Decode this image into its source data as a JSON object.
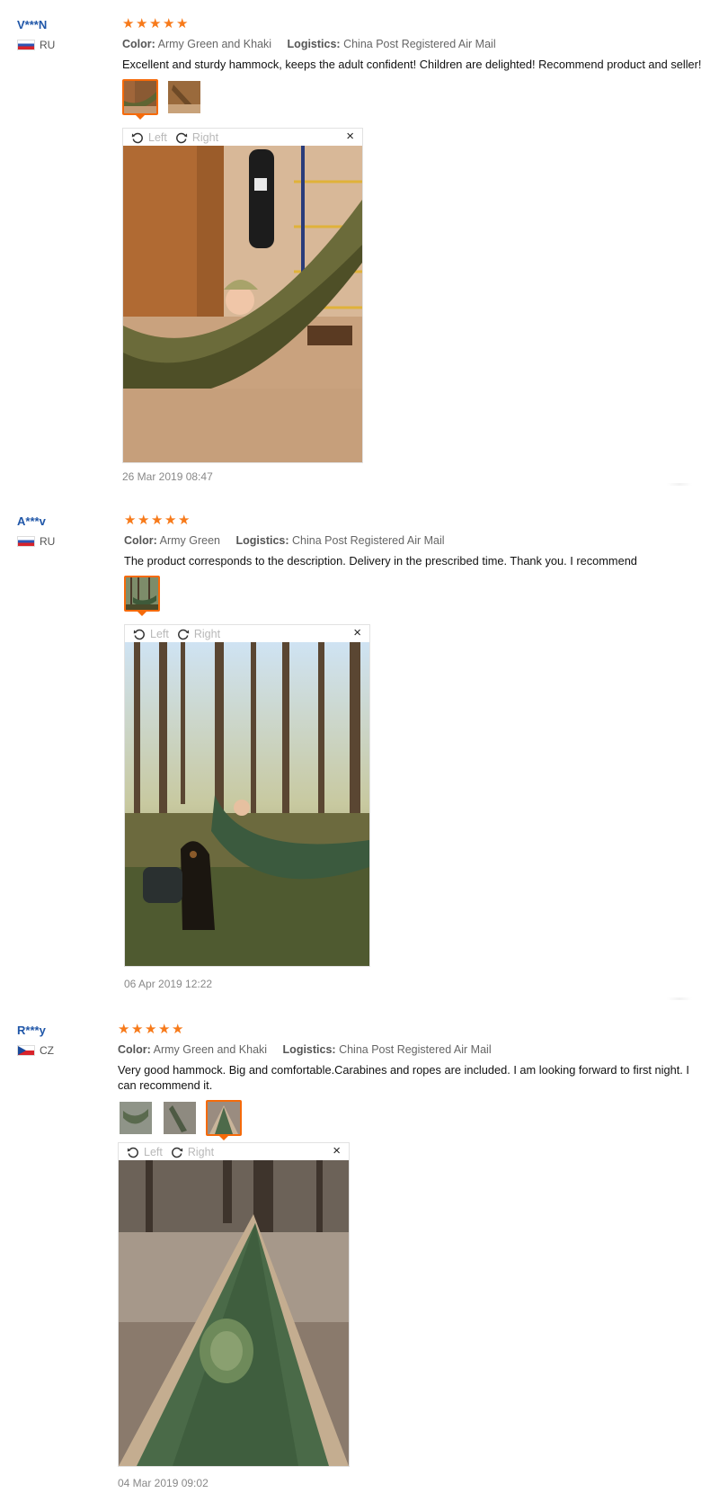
{
  "reviews": [
    {
      "user": "V***N",
      "country": "RU",
      "stars": 5,
      "color_label": "Color:",
      "color_value": "Army Green and Khaki",
      "logistics_label": "Logistics:",
      "logistics_value": "China Post Registered Air Mail",
      "text": "Excellent and sturdy hammock, keeps the adult confident! Children are delighted! Recommend product and seller!",
      "date": "26 Mar 2019 08:47",
      "photo_count": 2,
      "active_photo": 1
    },
    {
      "user": "A***v",
      "country": "RU",
      "stars": 5,
      "color_label": "Color:",
      "color_value": "Army Green",
      "logistics_label": "Logistics:",
      "logistics_value": "China Post Registered Air Mail",
      "text": "The product corresponds to the description. Delivery in the prescribed time. Thank you. I recommend",
      "date": "06 Apr 2019 12:22",
      "photo_count": 1,
      "active_photo": 1
    },
    {
      "user": "R***y",
      "country": "CZ",
      "stars": 5,
      "color_label": "Color:",
      "color_value": "Army Green and Khaki",
      "logistics_label": "Logistics:",
      "logistics_value": "China Post Registered Air Mail",
      "text": "Very good hammock. Big and comfortable.Carabines and ropes are included. I am looking forward to first night. I can recommend it.",
      "date": "04 Mar 2019 09:02",
      "photo_count": 3,
      "active_photo": 3
    }
  ],
  "viewer": {
    "left_label": "Left",
    "right_label": "Right",
    "close_glyph": "×",
    "rotate_left_icon": "rotate-left-icon",
    "rotate_right_icon": "rotate-right-icon"
  },
  "star_glyph": "★",
  "colors": {
    "username": "#1f56a8",
    "star": "#f77a1a",
    "active_thumb_border": "#f56a0a",
    "date": "#888888"
  }
}
